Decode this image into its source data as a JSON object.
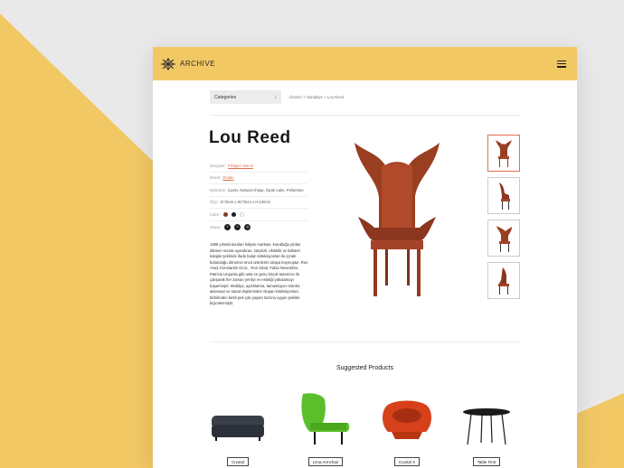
{
  "colors": {
    "accent": "#f2c865",
    "link": "#e36f52",
    "background": "#e9e9e9"
  },
  "header": {
    "logo_text": "ARCHIVE",
    "menu_icon": "hamburger-icon"
  },
  "filters": {
    "category_label": "Categories",
    "arrow": "↓"
  },
  "breadcrumb": "Ürünler > Sandalye > Lou Reed",
  "product": {
    "title": "Lou Reed",
    "designer_label": "Designer:",
    "designer_value": "Philippe Starck",
    "brand_label": "Brand:",
    "brand_value": "Driade",
    "material_label": "Malzeme:",
    "material_value": "Çavlu, Natural Ahşap, Siyah Lake, Poliüretan",
    "size_label": "Ölçü:",
    "size_value": "D:76cm x W:75cm x H:120cm",
    "color_label": "Color:",
    "share_label": "Share:",
    "description": "1968 yılında kurulan İtalyan markası, kurulduğu yıldan itibaren merak uyandıran, sürprizli, eklektik ve kültürel kolajlar şeklinde ifade bulan koleksiyonları ile içinde bulunduğu dönemin öncü ürünlerini ortaya koymuştur. Ron Arad, Konstantin Grcic , Ron Gilad, Fabio Novembre, Patricia Urquiola gibi usta ve genç birçok tasarımcı ile çalışarak her zaman yenilyi ve estetiği yakalamayı başarmıştır. Mobilya, aydınlatma, tamamlayıcı ürünler, aksesuar ve sanat objelerinden oluşan koleksiyonları, birbirinden farklı pek çok yaşam tarzına uygun şekilde biçimlenmiştir."
  },
  "suggested": {
    "title": "Suggested Products",
    "items": [
      {
        "label": "Crystal"
      },
      {
        "label": "Lima Armchair"
      },
      {
        "label": "Crystal X"
      },
      {
        "label": "Table First"
      }
    ]
  }
}
